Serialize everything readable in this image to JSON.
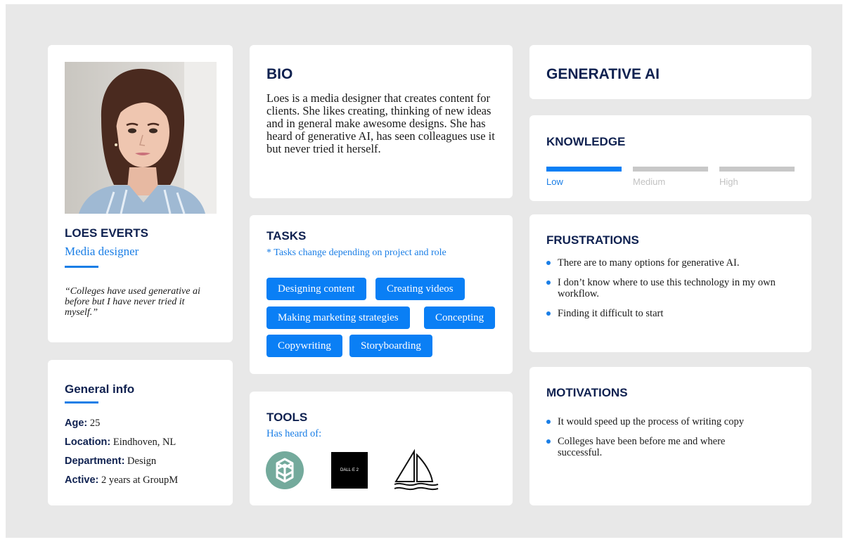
{
  "persona": {
    "name": "LOES EVERTS",
    "role": "Media designer",
    "quote": "“Colleges have used generative ai before but I have never tried it myself.”"
  },
  "general_info": {
    "title": "General info",
    "rows": [
      {
        "key": "Age:",
        "value": "25"
      },
      {
        "key": "Location:",
        "value": "Eindhoven, NL"
      },
      {
        "key": "Department:",
        "value": "Design"
      },
      {
        "key": "Active:",
        "value": "2 years at GroupM"
      }
    ]
  },
  "bio": {
    "title": "BIO",
    "text": "Loes is a media designer that creates content for clients. She likes creating, thinking of new ideas and in general make awesome designs. She has heard of generative AI, has seen colleagues use it but never tried it herself."
  },
  "tasks": {
    "title": "TASKS",
    "note": "* Tasks change depending on project and role",
    "items": [
      "Designing content",
      "Creating videos",
      "Making marketing strategies",
      "Concepting",
      "Copywriting",
      "Storyboarding"
    ]
  },
  "tools": {
    "title": "TOOLS",
    "subtitle": "Has heard of:",
    "logos": [
      {
        "icon": "chatgpt-logo-icon"
      },
      {
        "icon": "dalle-logo-icon",
        "text": "DALL·E 2"
      },
      {
        "icon": "midjourney-logo-icon"
      }
    ]
  },
  "generative_ai": {
    "title": "GENERATIVE AI"
  },
  "knowledge": {
    "title": "KNOWLEDGE",
    "levels": [
      "Low",
      "Medium",
      "High"
    ],
    "selected": "Low",
    "level_fraction": 0.333
  },
  "frustrations": {
    "title": "FRUSTRATIONS",
    "items": [
      "There are to many options for generative AI.",
      "I don’t know where to use this technology in my own workflow.",
      "Finding it difficult to start"
    ]
  },
  "motivations": {
    "title": "MOTIVATIONS",
    "items": [
      "It would speed up the process of writing copy",
      "Colleges have been before me and where successful."
    ]
  },
  "colors": {
    "navy": "#0f2150",
    "accent": "#1a7ee6",
    "chip": "#0a7ff5",
    "bar_inactive": "#c8c8c8",
    "canvas": "#e8e8e8"
  }
}
